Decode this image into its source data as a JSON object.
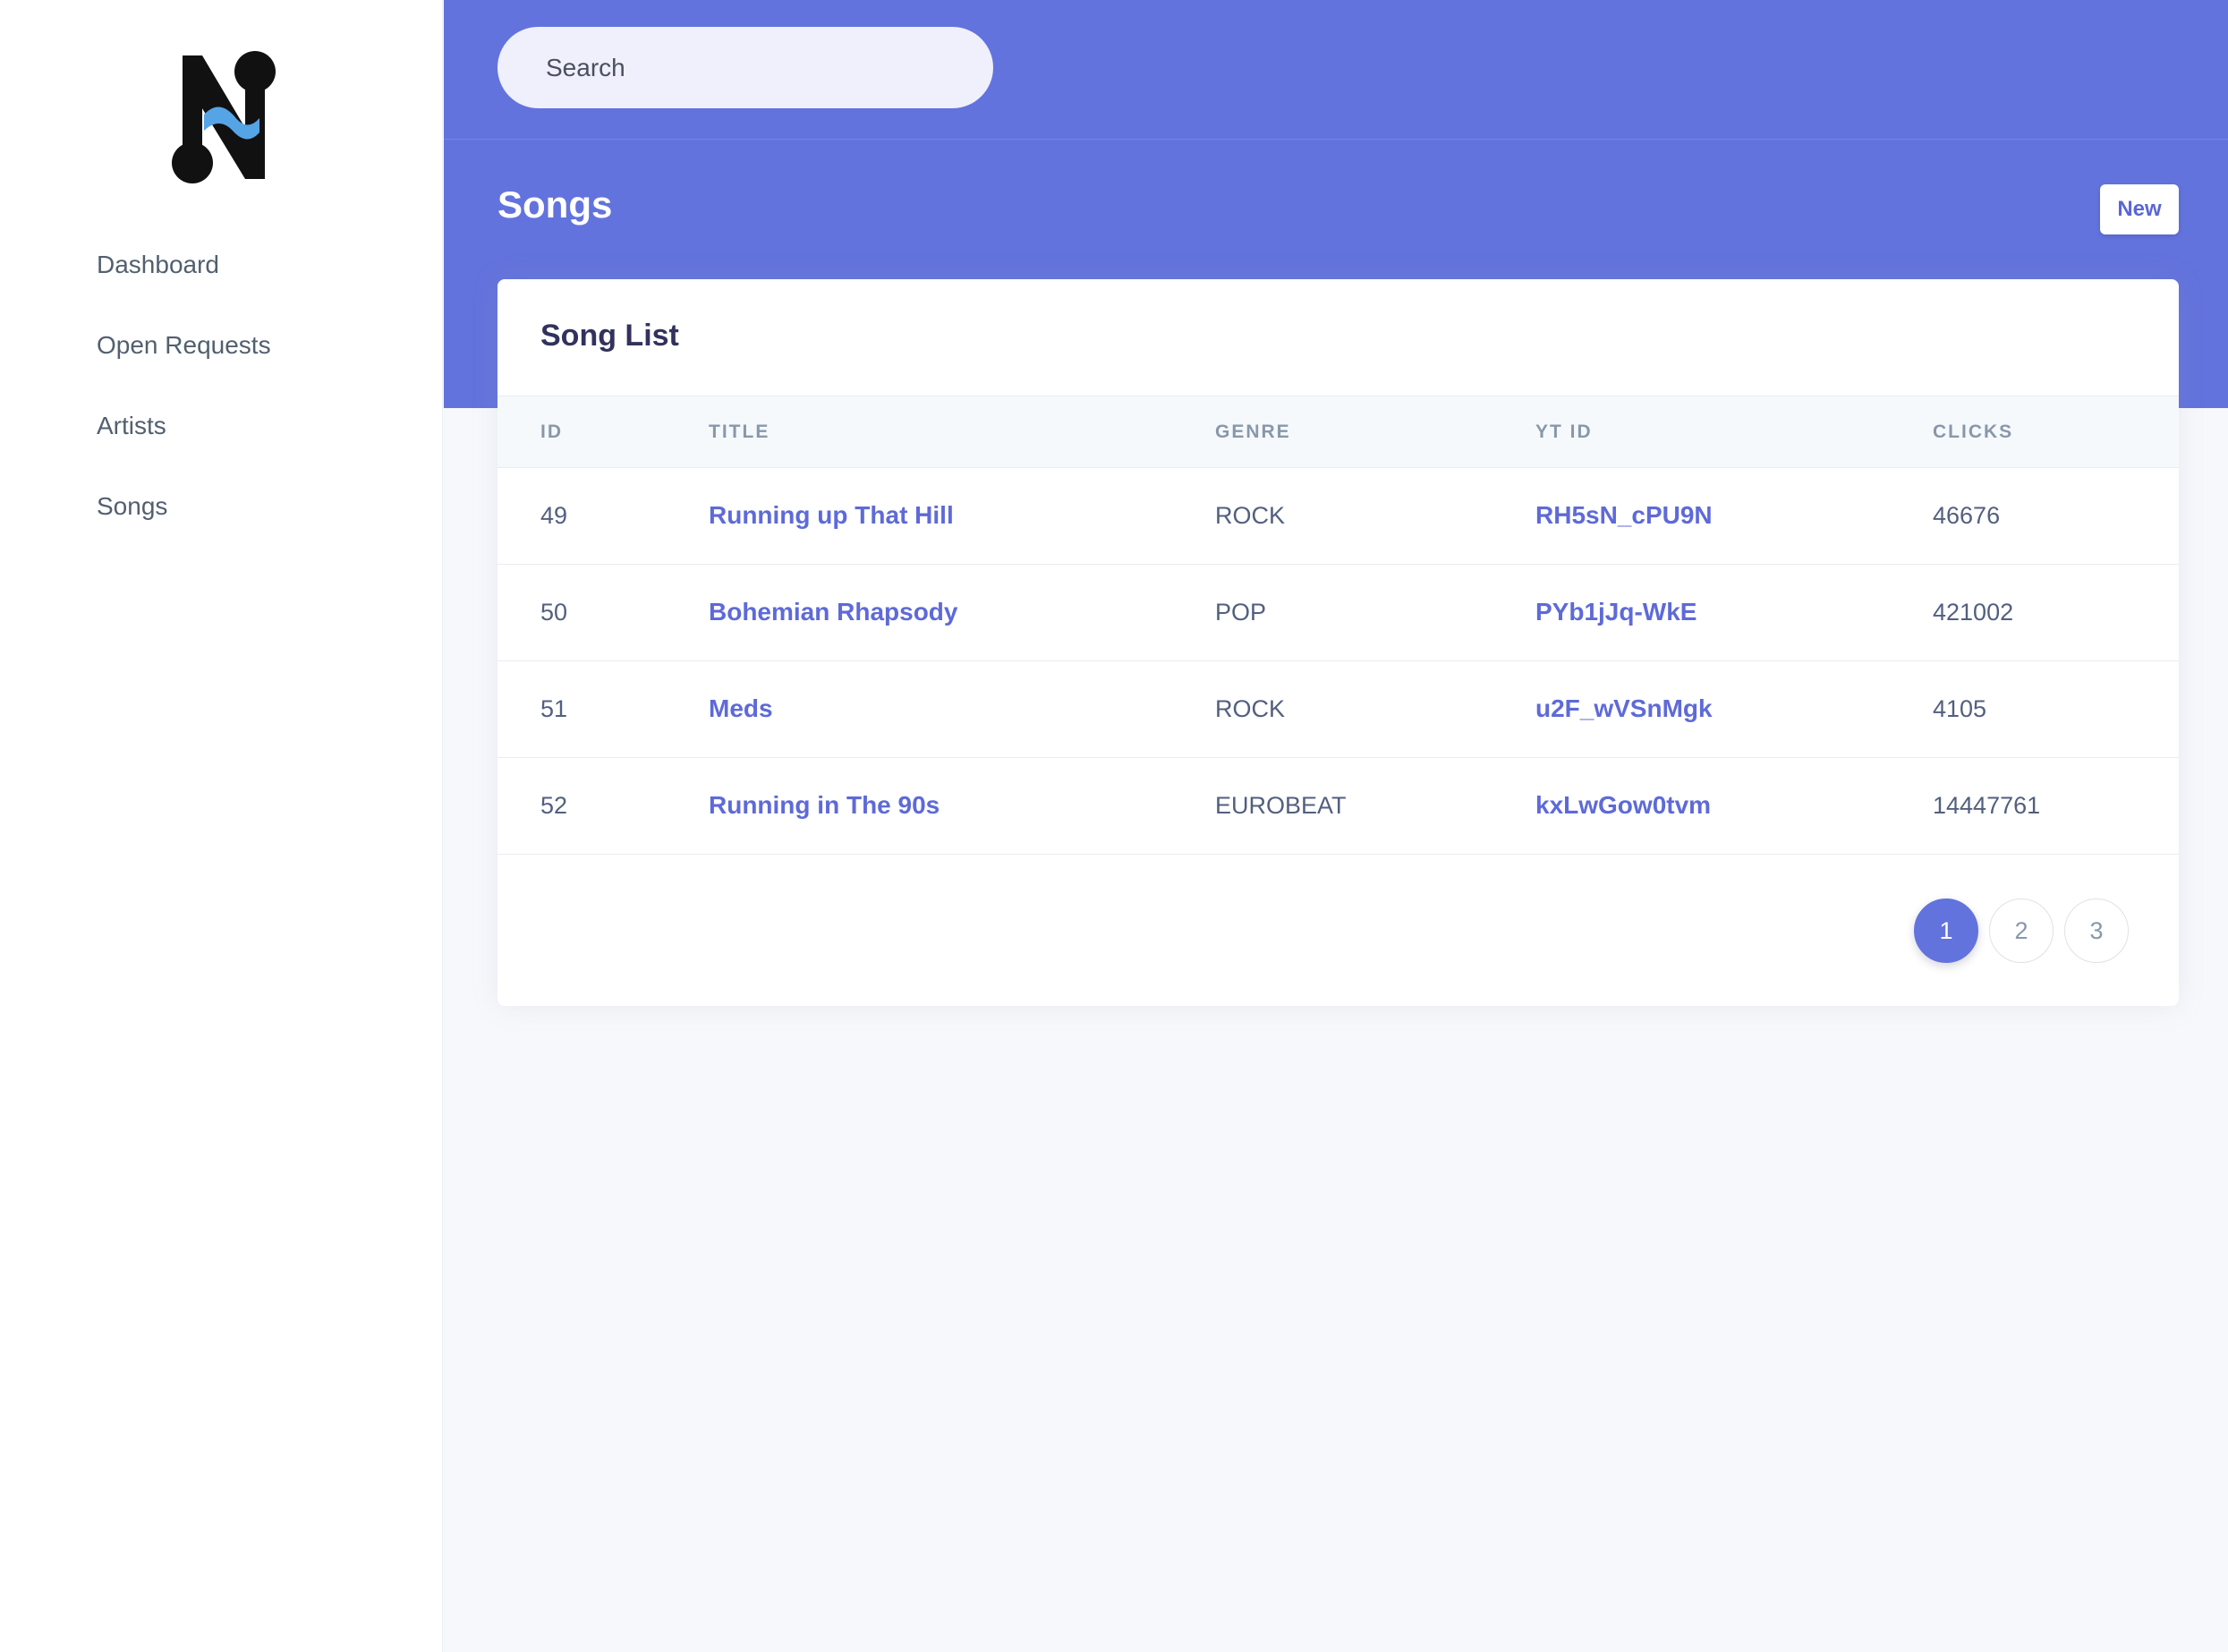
{
  "colors": {
    "accent": "#6373dd",
    "link": "#5e6ad8",
    "logo_black": "#111111",
    "logo_blue": "#55a4e6"
  },
  "sidebar": {
    "logo_icon": "music-note-n-logo",
    "items": [
      {
        "label": "Dashboard"
      },
      {
        "label": "Open Requests"
      },
      {
        "label": "Artists"
      },
      {
        "label": "Songs"
      }
    ]
  },
  "header": {
    "search_placeholder": "Search",
    "page_title": "Songs",
    "new_button": "New"
  },
  "table": {
    "title": "Song List",
    "columns": [
      "ID",
      "TITLE",
      "GENRE",
      "YT ID",
      "CLICKS"
    ],
    "rows": [
      {
        "id": "49",
        "title": "Running up That Hill",
        "genre": "ROCK",
        "yt_id": "RH5sN_cPU9N",
        "clicks": "46676"
      },
      {
        "id": "50",
        "title": "Bohemian Rhapsody",
        "genre": "POP",
        "yt_id": "PYb1jJq-WkE",
        "clicks": "421002"
      },
      {
        "id": "51",
        "title": "Meds",
        "genre": "ROCK",
        "yt_id": "u2F_wVSnMgk",
        "clicks": "4105"
      },
      {
        "id": "52",
        "title": "Running in The 90s",
        "genre": "EUROBEAT",
        "yt_id": "kxLwGow0tvm",
        "clicks": "14447761"
      }
    ]
  },
  "pagination": {
    "pages": [
      "1",
      "2",
      "3"
    ],
    "current": "1"
  }
}
